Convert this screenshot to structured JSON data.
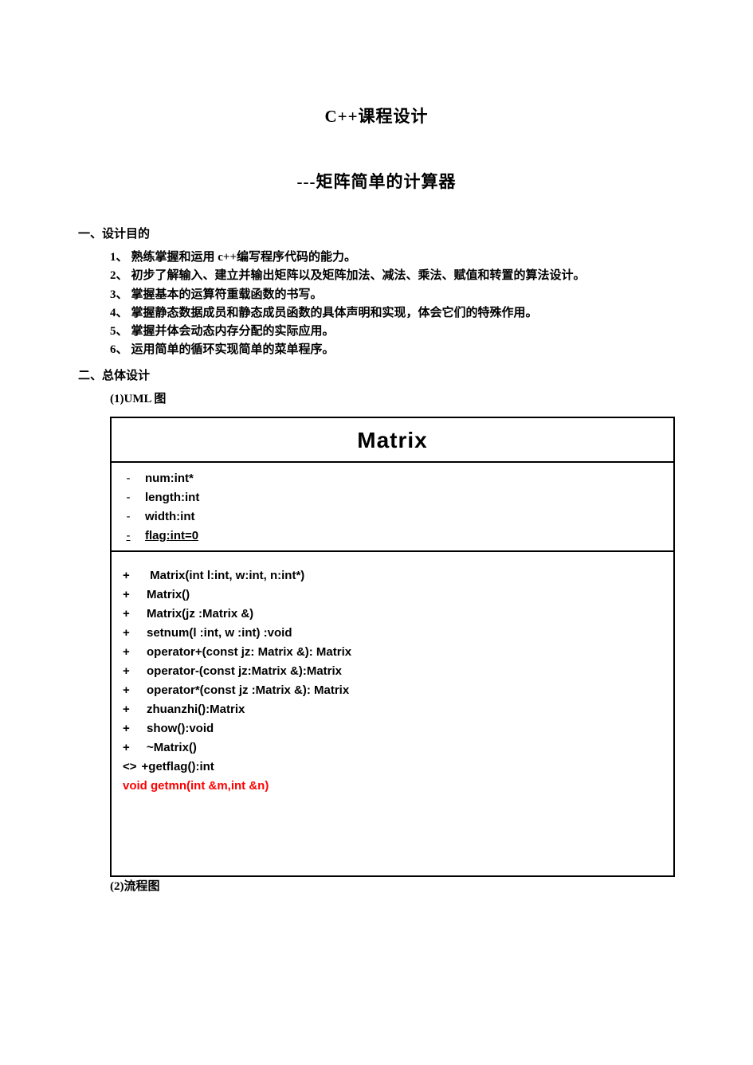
{
  "title_main": "C++课程设计",
  "title_sub": "---矩阵简单的计算器",
  "section1": {
    "heading": "一、设计目的",
    "items": [
      {
        "num": "1、",
        "text": "熟练掌握和运用 c++编写程序代码的能力。"
      },
      {
        "num": "2、",
        "text": "初步了解输入、建立并输出矩阵以及矩阵加法、减法、乘法、赋值和转置的算法设计。"
      },
      {
        "num": "3、",
        "text": "掌握基本的运算符重载函数的书写。"
      },
      {
        "num": "4、",
        "text": "掌握静态数据成员和静态成员函数的具体声明和实现，体会它们的特殊作用。"
      },
      {
        "num": "5、",
        "text": "掌握并体会动态内存分配的实际应用。"
      },
      {
        "num": "6、",
        "text": "运用简单的循环实现简单的菜单程序。"
      }
    ]
  },
  "section2": {
    "heading": "二、总体设计",
    "sub1": "(1)UML 图",
    "sub2": "(2)流程图"
  },
  "uml": {
    "class_name": "Matrix",
    "attrs": [
      {
        "vis": "-",
        "text": "num:int*",
        "underline": false
      },
      {
        "vis": "-",
        "text": "length:int",
        "underline": false
      },
      {
        "vis": "-",
        "text": "width:int",
        "underline": false
      },
      {
        "vis": "-",
        "text": "flag:int=0",
        "underline": true
      }
    ],
    "ops": [
      {
        "vis": "+",
        "text": " Matrix(int l:int, w:int, n:int*)",
        "friend": false
      },
      {
        "vis": "+",
        "text": "Matrix()",
        "friend": false
      },
      {
        "vis": "+",
        "text": "Matrix(jz :Matrix &)",
        "friend": false
      },
      {
        "vis": "+",
        "text": "setnum(l :int, w :int) :void",
        "friend": false
      },
      {
        "vis": "+",
        "text": "operator+(const jz: Matrix &): Matrix",
        "friend": false
      },
      {
        "vis": "+",
        "text": "operator-(const jz:Matrix &):Matrix",
        "friend": false
      },
      {
        "vis": "+",
        "text": "operator*(const jz :Matrix &): Matrix",
        "friend": false
      },
      {
        "vis": "+",
        "text": "zhuanzhi():Matrix",
        "friend": false
      },
      {
        "vis": "+",
        "text": "show():void",
        "friend": false
      },
      {
        "vis": "+",
        "text": "~Matrix()",
        "friend": false
      },
      {
        "vis": "<>",
        "text": "+getflag():int",
        "friend": false
      },
      {
        "vis": "",
        "text": "void getmn(int &m,int &n)",
        "friend": true
      }
    ]
  }
}
